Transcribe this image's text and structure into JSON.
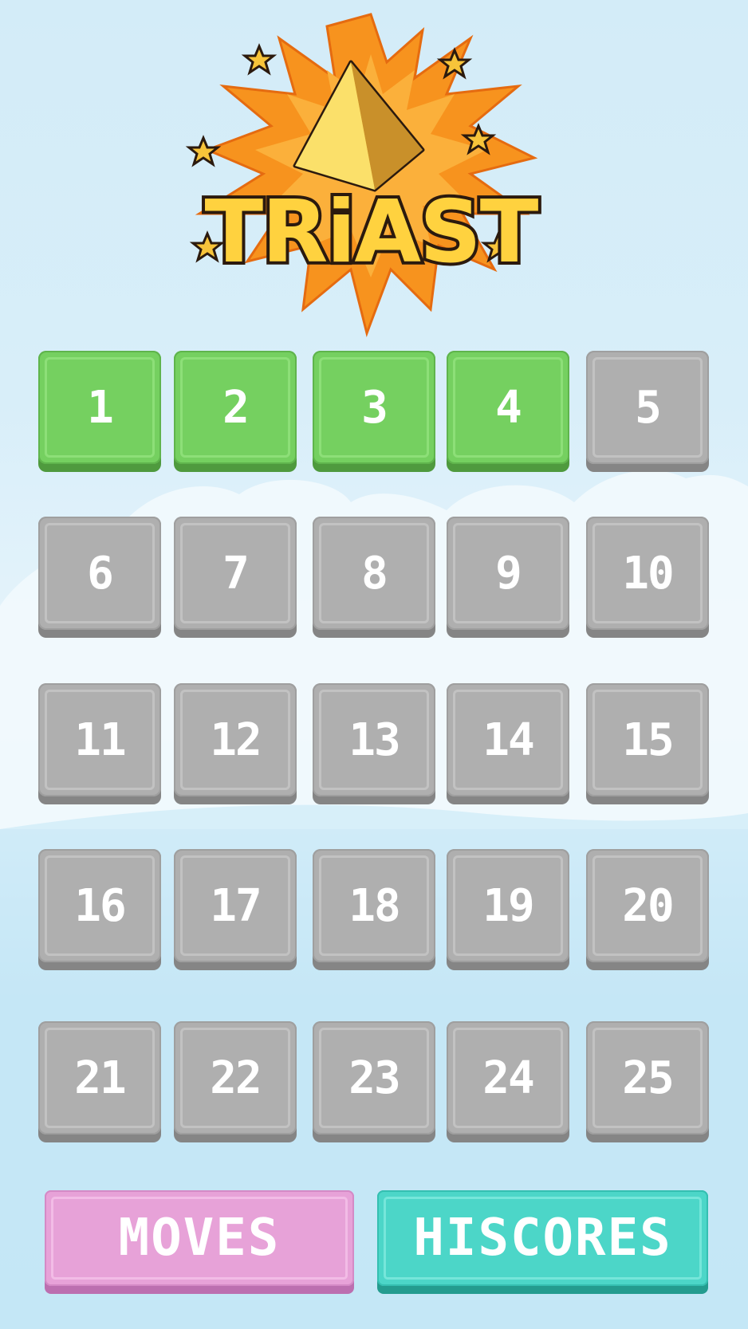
{
  "game": {
    "title": "TRiAST"
  },
  "levels": [
    {
      "label": "1",
      "state": "unlocked"
    },
    {
      "label": "2",
      "state": "unlocked"
    },
    {
      "label": "3",
      "state": "unlocked"
    },
    {
      "label": "4",
      "state": "unlocked"
    },
    {
      "label": "5",
      "state": "locked"
    },
    {
      "label": "6",
      "state": "locked"
    },
    {
      "label": "7",
      "state": "locked"
    },
    {
      "label": "8",
      "state": "locked"
    },
    {
      "label": "9",
      "state": "locked"
    },
    {
      "label": "10",
      "state": "locked"
    },
    {
      "label": "11",
      "state": "locked"
    },
    {
      "label": "12",
      "state": "locked"
    },
    {
      "label": "13",
      "state": "locked"
    },
    {
      "label": "14",
      "state": "locked"
    },
    {
      "label": "15",
      "state": "locked"
    },
    {
      "label": "16",
      "state": "locked"
    },
    {
      "label": "17",
      "state": "locked"
    },
    {
      "label": "18",
      "state": "locked"
    },
    {
      "label": "19",
      "state": "locked"
    },
    {
      "label": "20",
      "state": "locked"
    },
    {
      "label": "21",
      "state": "locked"
    },
    {
      "label": "22",
      "state": "locked"
    },
    {
      "label": "23",
      "state": "locked"
    },
    {
      "label": "24",
      "state": "locked"
    },
    {
      "label": "25",
      "state": "locked"
    }
  ],
  "buttons": {
    "moves_label": "MOVES",
    "hiscores_label": "HISCORES"
  },
  "colors": {
    "unlocked": "#75d060",
    "locked": "#afafaf",
    "moves": "#e7a2d8",
    "hiscores": "#4cd6c8",
    "sky": "#d3ecf8"
  }
}
